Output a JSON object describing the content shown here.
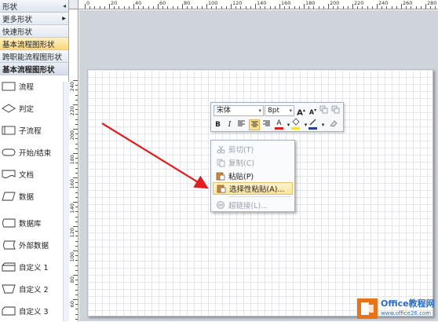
{
  "left_panel": {
    "header": "形状",
    "rows": [
      {
        "label": "更多形状",
        "arrow": "▸",
        "active": false
      },
      {
        "label": "快速形状",
        "arrow": "",
        "active": false
      },
      {
        "label": "基本流程图形状",
        "arrow": "",
        "active": true
      },
      {
        "label": "跨职能流程图形状",
        "arrow": "",
        "active": false
      }
    ],
    "section_header": "基本流程图形状",
    "shapes": [
      {
        "label": "流程",
        "icon": "process-shape-icon"
      },
      {
        "label": "判定",
        "icon": "decision-shape-icon"
      },
      {
        "label": "子流程",
        "icon": "subprocess-shape-icon"
      },
      {
        "label": "开始/结束",
        "icon": "terminator-shape-icon"
      },
      {
        "label": "文档",
        "icon": "document-shape-icon"
      },
      {
        "label": "数据",
        "icon": "data-shape-icon"
      },
      {
        "label": "数据库",
        "icon": "database-shape-icon"
      },
      {
        "label": "外部数据",
        "icon": "external-data-shape-icon"
      },
      {
        "label": "自定义 1",
        "icon": "custom1-shape-icon"
      },
      {
        "label": "自定义 2",
        "icon": "custom2-shape-icon"
      },
      {
        "label": "自定义 3",
        "icon": "custom3-shape-icon"
      }
    ]
  },
  "rulers": {
    "horizontal_labels": [
      "0",
      "20",
      "40",
      "60",
      "80",
      "100",
      "120",
      "140",
      "160",
      "180",
      "200",
      "220",
      "240",
      "260",
      "280"
    ],
    "vertical_labels": [
      "240",
      "220",
      "200",
      "180",
      "160",
      "140",
      "120",
      "100",
      "80",
      "60",
      "40",
      "20"
    ]
  },
  "mini_toolbar": {
    "font_name": "宋体",
    "font_size": "8pt",
    "grow_font": "A",
    "shrink_font": "A",
    "bold": "B",
    "italic": "I",
    "font_color": "A"
  },
  "context_menu": {
    "items": [
      {
        "label": "剪切(T)",
        "icon": "cut-icon",
        "disabled": true,
        "highlighted": false
      },
      {
        "label": "复制(C)",
        "icon": "copy-icon",
        "disabled": true,
        "highlighted": false
      },
      {
        "label": "粘贴(P)",
        "icon": "paste-icon",
        "disabled": false,
        "highlighted": false
      },
      {
        "label": "选择性粘贴(A)...",
        "icon": "paste-special-icon",
        "disabled": false,
        "highlighted": true
      },
      {
        "label": "超链接(L)...",
        "icon": "hyperlink-icon",
        "disabled": true,
        "highlighted": false
      }
    ]
  },
  "watermark": {
    "brand": "Office教程网",
    "url": "www.office26.com"
  },
  "colors": {
    "arrow": "#e02020",
    "font_color_bar": "#d62020",
    "highlight_bar": "#f5e033",
    "line_color_bar": "#1f3f9f",
    "watermark_orange": "#e8741a"
  }
}
